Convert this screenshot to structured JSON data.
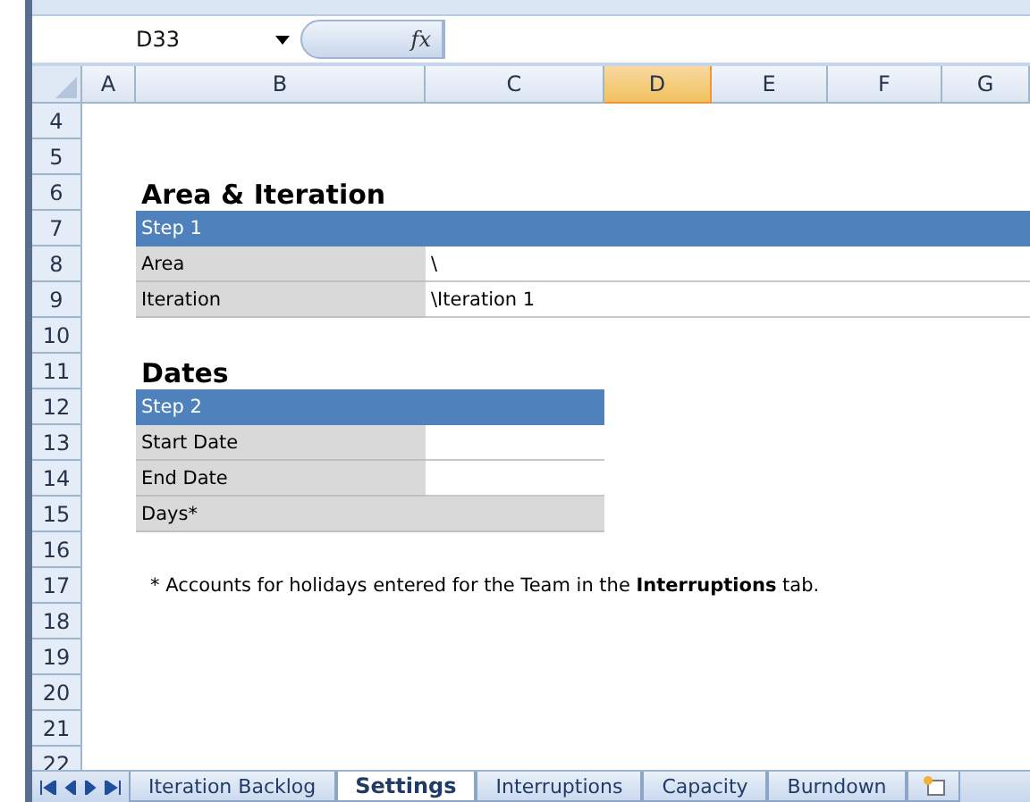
{
  "name_box": {
    "value": "D33"
  },
  "formula_bar": {
    "function_label": "fx"
  },
  "columns": [
    {
      "label": "A",
      "selected": false
    },
    {
      "label": "B",
      "selected": false
    },
    {
      "label": "C",
      "selected": false
    },
    {
      "label": "D",
      "selected": true
    },
    {
      "label": "E",
      "selected": false
    },
    {
      "label": "F",
      "selected": false
    },
    {
      "label": "G",
      "selected": false
    }
  ],
  "rows": [
    {
      "label": "4"
    },
    {
      "label": "5"
    },
    {
      "label": "6",
      "cells": [
        {
          "kind": "title",
          "text": "Area & Iteration"
        }
      ]
    },
    {
      "label": "7",
      "cells": [
        {
          "kind": "header_wide",
          "text": "Step 1"
        }
      ]
    },
    {
      "label": "8",
      "cells": [
        {
          "kind": "label",
          "text": "Area"
        },
        {
          "kind": "value_wide",
          "text": "\\"
        }
      ]
    },
    {
      "label": "9",
      "cells": [
        {
          "kind": "label",
          "text": "Iteration"
        },
        {
          "kind": "value_wide",
          "text": "\\Iteration 1"
        }
      ]
    },
    {
      "label": "10"
    },
    {
      "label": "11",
      "cells": [
        {
          "kind": "title",
          "text": "Dates"
        }
      ]
    },
    {
      "label": "12",
      "cells": [
        {
          "kind": "header",
          "text": "Step 2"
        }
      ]
    },
    {
      "label": "13",
      "cells": [
        {
          "kind": "label",
          "text": "Start Date"
        },
        {
          "kind": "value"
        }
      ]
    },
    {
      "label": "14",
      "cells": [
        {
          "kind": "label",
          "text": "End Date"
        },
        {
          "kind": "value"
        }
      ]
    },
    {
      "label": "15",
      "cells": [
        {
          "kind": "label_wide",
          "text": "Days*"
        }
      ]
    },
    {
      "label": "16"
    },
    {
      "label": "17",
      "cells": [
        {
          "kind": "note",
          "text": "* Accounts for holidays entered for the Team in the **Interruptions** tab."
        }
      ]
    },
    {
      "label": "18"
    },
    {
      "label": "19"
    },
    {
      "label": "20"
    },
    {
      "label": "21"
    },
    {
      "label": "22"
    }
  ],
  "sheet_tabs": [
    {
      "label": "Iteration Backlog",
      "selected": false
    },
    {
      "label": "Settings",
      "selected": true
    },
    {
      "label": "Interruptions",
      "selected": false
    },
    {
      "label": "Capacity",
      "selected": false
    },
    {
      "label": "Burndown",
      "selected": false
    }
  ]
}
